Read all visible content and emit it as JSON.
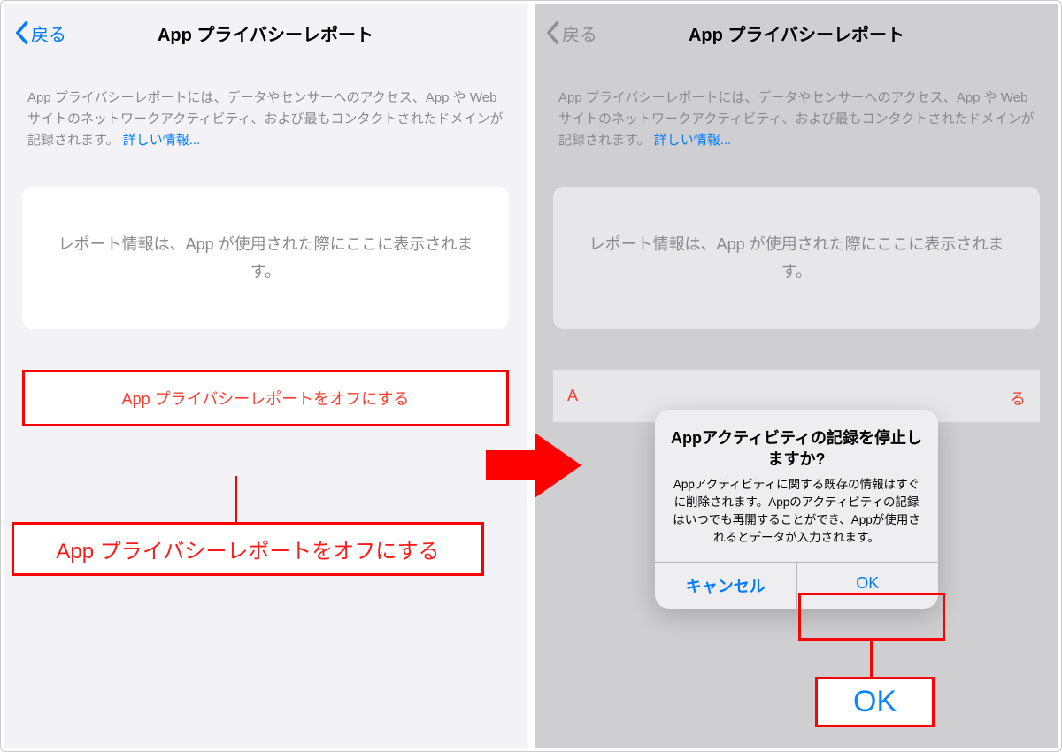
{
  "left": {
    "back_label": "戻る",
    "title": "App プライバシーレポート",
    "desc_text": "App プライバシーレポートには、データやセンサーへのアクセス、App や Web サイトのネットワークアクティビティ、および最もコンタクトされたドメインが記録されます。",
    "desc_link": "詳しい情報...",
    "card_text": "レポート情報は、App が使用された際にここに表示されます。",
    "off_button": "App プライバシーレポートをオフにする",
    "callout": "App プライバシーレポートをオフにする"
  },
  "right": {
    "back_label": "戻る",
    "title": "App プライバシーレポート",
    "desc_text": "App プライバシーレポートには、データやセンサーへのアクセス、App や Web サイトのネットワークアクティビティ、および最もコンタクトされたドメインが記録されます。",
    "desc_link": "詳しい情報...",
    "card_text": "レポート情報は、App が使用された際にここに表示されます。",
    "off_button_partial_left": "A",
    "off_button_partial_right": "る",
    "alert": {
      "title": "Appアクティビティの記録を停止しますか?",
      "message": "Appアクティビティに関する既存の情報はすぐに削除されます。Appのアクティビティの記録はいつでも再開することができ、Appが使用されるとデータが入力されます。",
      "cancel": "キャンセル",
      "ok": "OK"
    },
    "callout_ok": "OK"
  },
  "colors": {
    "accent_blue": "#007aff",
    "destructive_red": "#ff3b30",
    "annotation_red": "#ff0000"
  }
}
